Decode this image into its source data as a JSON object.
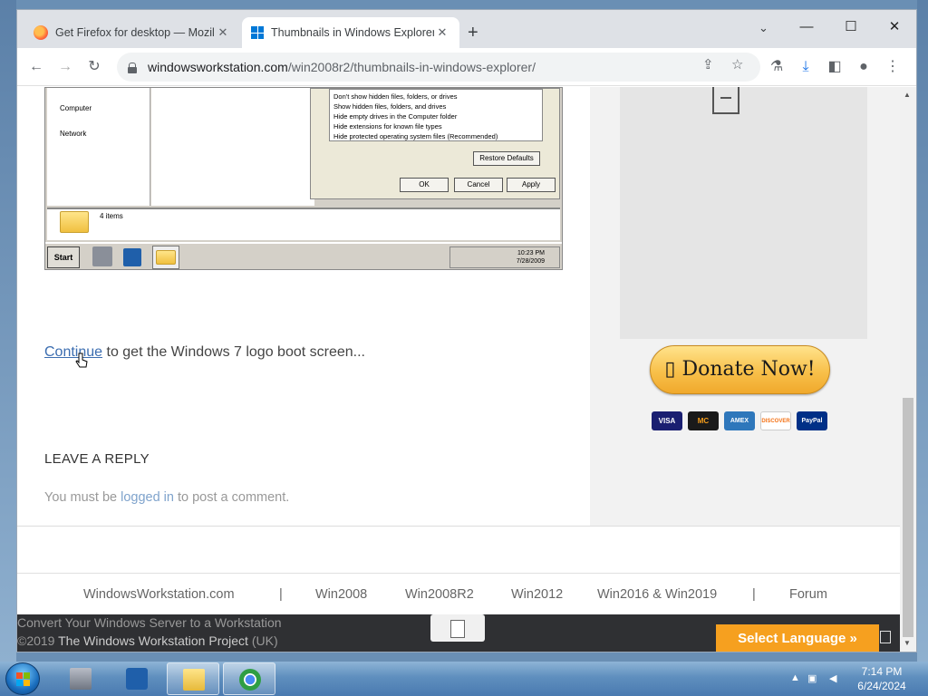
{
  "browser": {
    "tabs": [
      {
        "title": "Get Firefox for desktop — Mozilla"
      },
      {
        "title": "Thumbnails in Windows Explorer"
      }
    ],
    "new_tab": "+",
    "url": {
      "host": "windowsworkstation.com",
      "path": "/win2008r2/thumbnails-in-windows-explorer/"
    }
  },
  "embedded_screenshot": {
    "nav_items": [
      "Computer",
      "Network"
    ],
    "options": [
      "Don't show hidden files, folders, or drives",
      "Show hidden files, folders, and drives",
      "Hide empty drives in the Computer folder",
      "Hide extensions for known file types",
      "Hide protected operating system files (Recommended)"
    ],
    "restore_defaults": "Restore Defaults",
    "ok": "OK",
    "cancel": "Cancel",
    "apply": "Apply",
    "status_items": "4 items",
    "start": "Start",
    "tray_time": "10:23 PM",
    "tray_date": "7/28/2009"
  },
  "article": {
    "continue_link": "Continue",
    "continue_rest": " to get the Windows 7 logo boot screen...",
    "reply_heading": "LEAVE A REPLY",
    "login_pre": "You must be ",
    "login_link": "logged in",
    "login_post": " to post a comment."
  },
  "sidebar": {
    "donate_label": "Donate Now!",
    "cards": [
      "VISA",
      "MC",
      "AMEX",
      "DISCOVER",
      "PayPal"
    ]
  },
  "footer": {
    "nav": [
      "WindowsWorkstation.com",
      "|",
      "Win2008",
      "Win2008R2",
      "Win2012",
      "Win2016 & Win2019",
      "|",
      "Forum"
    ],
    "line1": "Convert Your Windows Server to a Workstation",
    "line2_copy": "©2019 ",
    "line2_name": "The Windows Workstation Project",
    "line2_uk": " (UK)",
    "select_language": "Select Language »"
  },
  "os_taskbar": {
    "time": "7:14 PM",
    "date": "6/24/2024"
  },
  "colors": {
    "link": "#3b6db0",
    "donate": "#f8c04a",
    "select_language": "#f6a01f",
    "footer_bar": "#2f3033"
  }
}
